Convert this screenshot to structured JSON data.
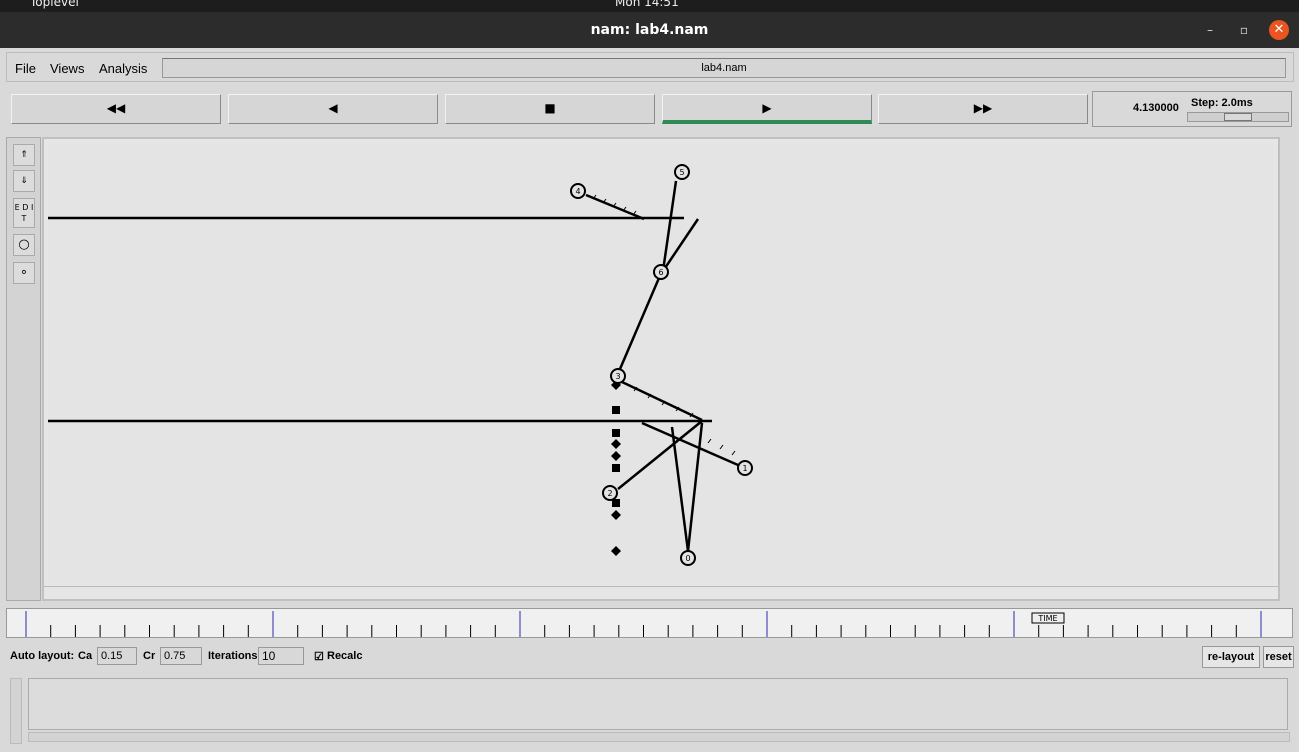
{
  "os": {
    "toplevel_label": "Toplevel",
    "clock": "Mon 14:51"
  },
  "window": {
    "title": "nam: lab4.nam",
    "minimize": "–",
    "maximize": "▫",
    "close": "✕"
  },
  "menu": {
    "file": "File",
    "views": "Views",
    "analysis": "Analysis"
  },
  "filename": "lab4.nam",
  "playback": {
    "rewind": "◀◀",
    "back": "◀",
    "stop": "■",
    "play": "▶",
    "forward": "▶▶",
    "active": "play"
  },
  "time": {
    "current": "4.130000",
    "step_label": "Step: 2.0ms",
    "step_slider_fraction": 0.5
  },
  "tools": {
    "zoom_in": "⇑",
    "zoom_out": "⇓",
    "edit": "E D I T",
    "circle_large": "○",
    "circle_small": "∘"
  },
  "network": {
    "nodes": [
      {
        "id": "0"
      },
      {
        "id": "1"
      },
      {
        "id": "2"
      },
      {
        "id": "3"
      },
      {
        "id": "4"
      },
      {
        "id": "5"
      },
      {
        "id": "6"
      }
    ],
    "links": [
      [
        "4",
        "6"
      ],
      [
        "5",
        "6"
      ],
      [
        "6",
        "3"
      ],
      [
        "3",
        "1"
      ],
      [
        "2",
        "0"
      ],
      [
        "3",
        "0"
      ]
    ]
  },
  "timeline": {
    "marker_label": "TIME"
  },
  "auto_layout": {
    "label": "Auto layout:",
    "ca_label": "Ca",
    "ca_value": "0.15",
    "cr_label": "Cr",
    "cr_value": "0.75",
    "iterations_label": "Iterations",
    "iterations_value": "10",
    "recalc_label": "Recalc",
    "recalc_checked": true,
    "relayout_button": "re-layout",
    "reset_button": "reset"
  }
}
